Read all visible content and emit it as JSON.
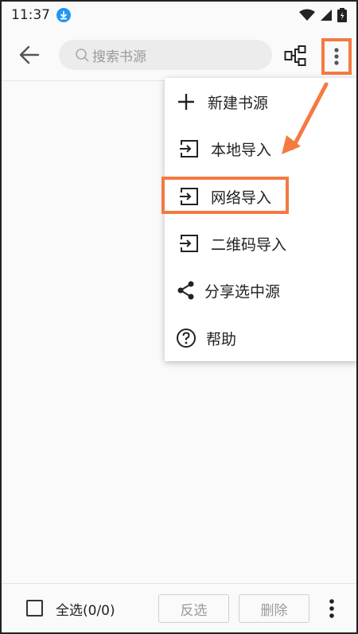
{
  "status": {
    "time": "11:37",
    "icons": [
      "download-notification-icon",
      "wifi-icon",
      "cellular-icon",
      "battery-icon"
    ]
  },
  "toolbar": {
    "search_placeholder": "搜索书源"
  },
  "menu": {
    "items": [
      {
        "label": "新建书源",
        "icon": "plus-icon"
      },
      {
        "label": "本地导入",
        "icon": "import-icon"
      },
      {
        "label": "网络导入",
        "icon": "import-icon"
      },
      {
        "label": "二维码导入",
        "icon": "import-icon"
      },
      {
        "label": "分享选中源",
        "icon": "share-icon"
      },
      {
        "label": "帮助",
        "icon": "help-icon"
      }
    ]
  },
  "bottom": {
    "select_all": "全选(0/0)",
    "invert": "反选",
    "delete": "删除"
  },
  "colors": {
    "accent": "#f47a42",
    "badge": "#2196f3"
  }
}
